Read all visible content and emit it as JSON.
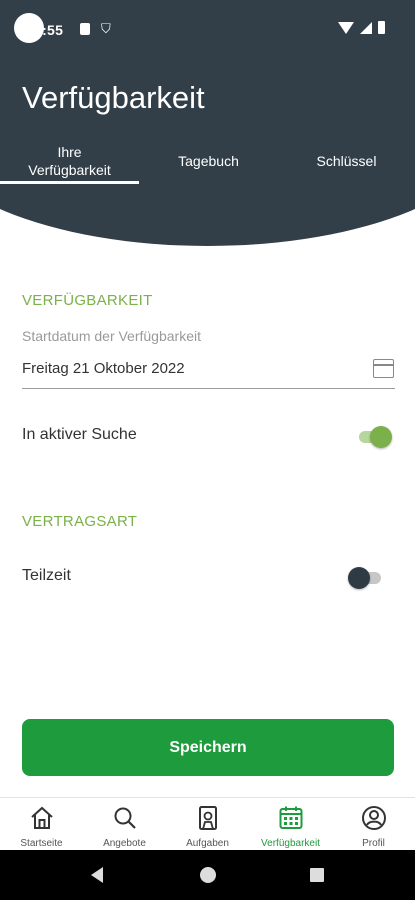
{
  "status_bar": {
    "time": "3:55"
  },
  "header": {
    "title": "Verfügbarkeit"
  },
  "tabs": [
    {
      "label": "Ihre\nVerfügbarkeit",
      "active": true
    },
    {
      "label": "Tagebuch",
      "active": false
    },
    {
      "label": "Schlüssel",
      "active": false
    }
  ],
  "availability": {
    "section_title": "VERFÜGBARKEIT",
    "start_date_label": "Startdatum der Verfügbarkeit",
    "start_date_value": "Freitag 21 Oktober 2022",
    "active_search_label": "In aktiver Suche",
    "active_search_on": true
  },
  "contract": {
    "section_title": "VERTRAGSART",
    "part_time_label": "Teilzeit",
    "part_time_on": false
  },
  "save_button": {
    "label": "Speichern"
  },
  "bottom_nav": [
    {
      "label": "Startseite",
      "icon": "home-icon",
      "active": false
    },
    {
      "label": "Angebote",
      "icon": "search-icon",
      "active": false
    },
    {
      "label": "Aufgaben",
      "icon": "task-icon",
      "active": false
    },
    {
      "label": "Verfügbarkeit",
      "icon": "calendar-icon",
      "active": true
    },
    {
      "label": "Profil",
      "icon": "profile-icon",
      "active": false
    }
  ],
  "colors": {
    "header": "#333f48",
    "accent_green": "#7bb04a",
    "button_green": "#1e9b3c"
  }
}
